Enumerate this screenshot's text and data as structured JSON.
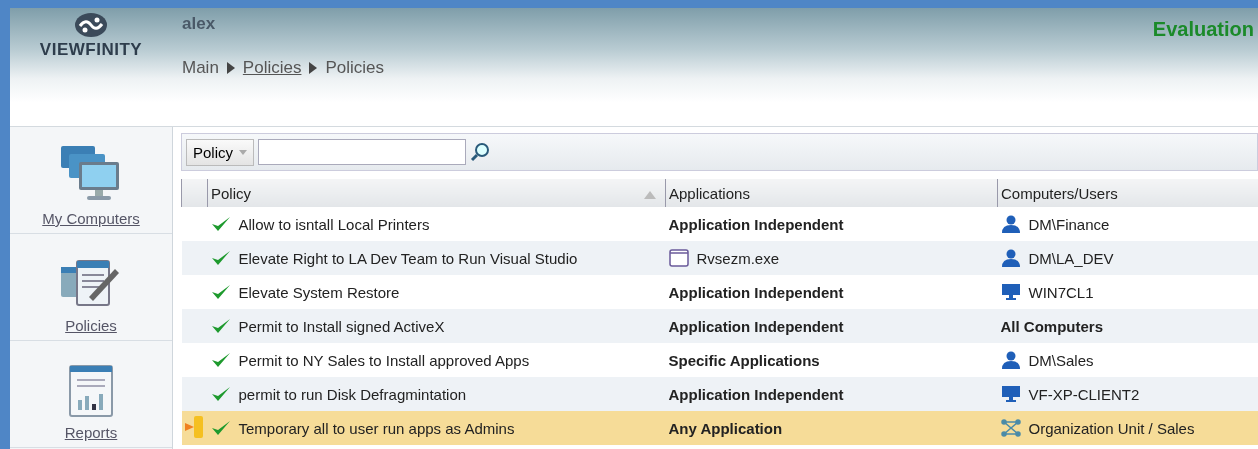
{
  "header": {
    "brand": "VIEWFINITY",
    "user": "alex",
    "license": "Evaluation",
    "breadcrumb": [
      {
        "label": "Main",
        "link": false
      },
      {
        "label": "Policies",
        "link": true
      },
      {
        "label": "Policies",
        "link": false
      }
    ]
  },
  "sidebar": {
    "items": [
      {
        "label": "My Computers",
        "kind": "computers"
      },
      {
        "label": "Policies",
        "kind": "policies"
      },
      {
        "label": "Reports",
        "kind": "reports"
      }
    ]
  },
  "toolbar": {
    "filter": "Policy"
  },
  "table": {
    "columns": [
      "Policy",
      "Applications",
      "Computers/Users"
    ],
    "rows": [
      {
        "enabled": true,
        "selected": false,
        "policy": "Allow to isntall Local Printers",
        "application": {
          "kind": "category",
          "text": "Application Independent"
        },
        "target": {
          "kind": "user",
          "text": "DM\\Finance"
        }
      },
      {
        "enabled": true,
        "selected": false,
        "policy": "Elevate Right to LA Dev Team to Run Visual Studio",
        "application": {
          "kind": "file",
          "text": "Rvsezm.exe"
        },
        "target": {
          "kind": "user",
          "text": "DM\\LA_DEV"
        }
      },
      {
        "enabled": true,
        "selected": false,
        "policy": "Elevate System Restore",
        "application": {
          "kind": "category",
          "text": "Application Independent"
        },
        "target": {
          "kind": "computer",
          "text": "WIN7CL1"
        }
      },
      {
        "enabled": true,
        "selected": false,
        "policy": "Permit to Install signed ActiveX",
        "application": {
          "kind": "category",
          "text": "Application Independent"
        },
        "target": {
          "kind": "all",
          "text": "All Computers"
        }
      },
      {
        "enabled": true,
        "selected": false,
        "policy": "Permit to NY Sales to Install approved Apps",
        "application": {
          "kind": "category",
          "text": "Specific Applications"
        },
        "target": {
          "kind": "user",
          "text": "DM\\Sales"
        }
      },
      {
        "enabled": true,
        "selected": false,
        "policy": "permit to run Disk Defragmintation",
        "application": {
          "kind": "category",
          "text": "Application Independent"
        },
        "target": {
          "kind": "computer",
          "text": "VF-XP-CLIENT2"
        }
      },
      {
        "enabled": true,
        "selected": true,
        "policy": "Temporary all to user run apps as Admins",
        "application": {
          "kind": "category",
          "text": "Any Application"
        },
        "target": {
          "kind": "ou",
          "text": "Organization Unit / Sales"
        }
      }
    ]
  }
}
